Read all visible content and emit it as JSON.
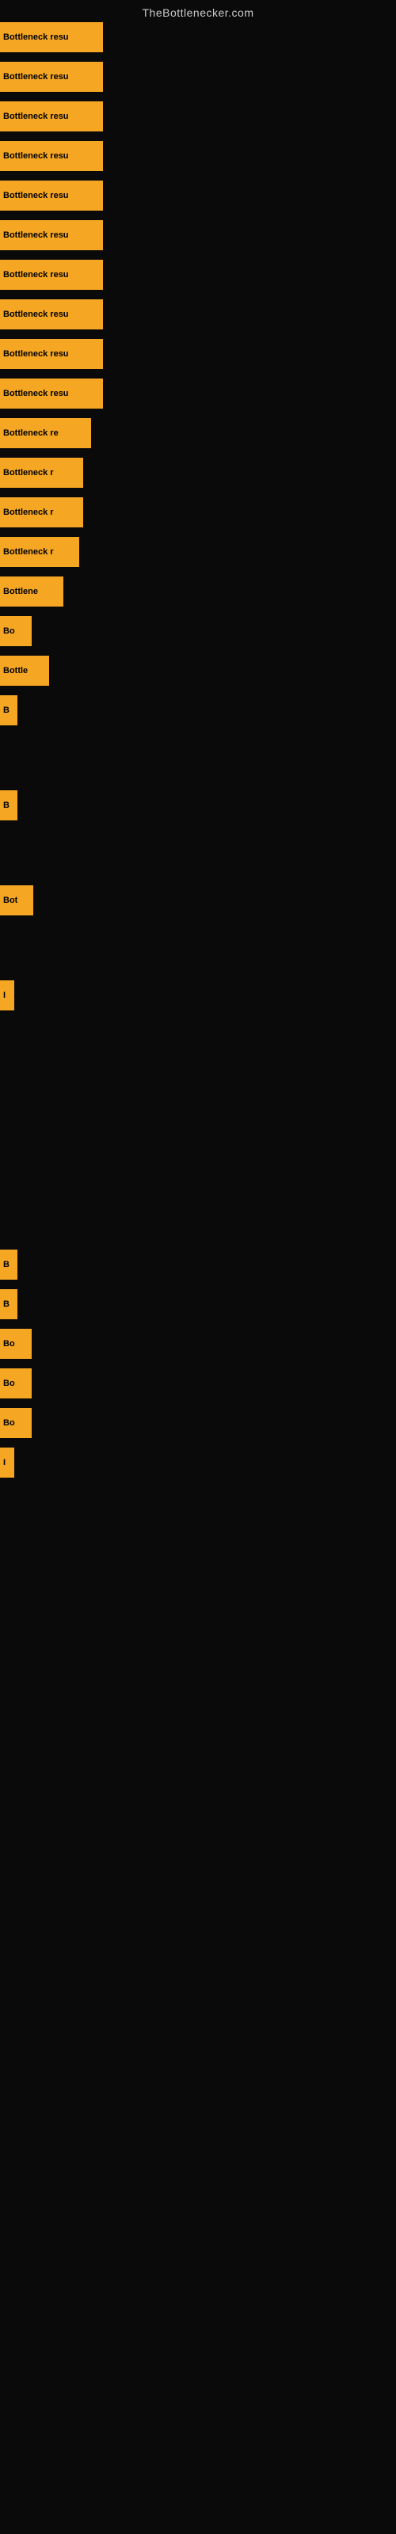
{
  "site": {
    "title": "TheBottlenecker.com"
  },
  "bars": [
    {
      "id": 1,
      "label": "Bottleneck resu",
      "width": 130,
      "height": 38,
      "gap_after": 10
    },
    {
      "id": 2,
      "label": "Bottleneck resu",
      "width": 130,
      "height": 38,
      "gap_after": 10
    },
    {
      "id": 3,
      "label": "Bottleneck resu",
      "width": 130,
      "height": 38,
      "gap_after": 10
    },
    {
      "id": 4,
      "label": "Bottleneck resu",
      "width": 130,
      "height": 38,
      "gap_after": 10
    },
    {
      "id": 5,
      "label": "Bottleneck resu",
      "width": 130,
      "height": 38,
      "gap_after": 10
    },
    {
      "id": 6,
      "label": "Bottleneck resu",
      "width": 130,
      "height": 38,
      "gap_after": 10
    },
    {
      "id": 7,
      "label": "Bottleneck resu",
      "width": 130,
      "height": 38,
      "gap_after": 10
    },
    {
      "id": 8,
      "label": "Bottleneck resu",
      "width": 130,
      "height": 38,
      "gap_after": 10
    },
    {
      "id": 9,
      "label": "Bottleneck resu",
      "width": 130,
      "height": 38,
      "gap_after": 10
    },
    {
      "id": 10,
      "label": "Bottleneck resu",
      "width": 130,
      "height": 38,
      "gap_after": 10
    },
    {
      "id": 11,
      "label": "Bottleneck re",
      "width": 115,
      "height": 38,
      "gap_after": 10
    },
    {
      "id": 12,
      "label": "Bottleneck r",
      "width": 105,
      "height": 38,
      "gap_after": 10
    },
    {
      "id": 13,
      "label": "Bottleneck r",
      "width": 105,
      "height": 38,
      "gap_after": 10
    },
    {
      "id": 14,
      "label": "Bottleneck r",
      "width": 100,
      "height": 38,
      "gap_after": 10
    },
    {
      "id": 15,
      "label": "Bottlene",
      "width": 80,
      "height": 38,
      "gap_after": 10
    },
    {
      "id": 16,
      "label": "Bo",
      "width": 40,
      "height": 38,
      "gap_after": 10
    },
    {
      "id": 17,
      "label": "Bottle",
      "width": 62,
      "height": 38,
      "gap_after": 10
    },
    {
      "id": 18,
      "label": "B",
      "width": 22,
      "height": 38,
      "gap_after": 80
    },
    {
      "id": 19,
      "label": "B",
      "width": 22,
      "height": 38,
      "gap_after": 80
    },
    {
      "id": 20,
      "label": "Bot",
      "width": 42,
      "height": 38,
      "gap_after": 80
    },
    {
      "id": 21,
      "label": "I",
      "width": 18,
      "height": 38,
      "gap_after": 300
    },
    {
      "id": 22,
      "label": "B",
      "width": 22,
      "height": 38,
      "gap_after": 10
    },
    {
      "id": 23,
      "label": "B",
      "width": 22,
      "height": 38,
      "gap_after": 10
    },
    {
      "id": 24,
      "label": "Bo",
      "width": 40,
      "height": 38,
      "gap_after": 10
    },
    {
      "id": 25,
      "label": "Bo",
      "width": 40,
      "height": 38,
      "gap_after": 10
    },
    {
      "id": 26,
      "label": "Bo",
      "width": 40,
      "height": 38,
      "gap_after": 10
    },
    {
      "id": 27,
      "label": "I",
      "width": 18,
      "height": 38,
      "gap_after": 10
    }
  ]
}
